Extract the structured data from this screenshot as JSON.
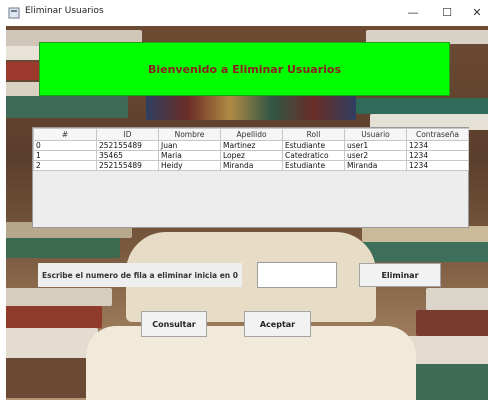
{
  "window": {
    "title": "Eliminar Usuarios",
    "minimize_glyph": "—",
    "maximize_glyph": "☐",
    "close_glyph": "✕"
  },
  "banner": {
    "text": "Bienvenido a Eliminar Usuarios"
  },
  "table": {
    "headers": [
      "#",
      "ID",
      "Nombre",
      "Apellido",
      "Roll",
      "Usuario",
      "Contraseña"
    ],
    "rows": [
      [
        "0",
        "252155489",
        "Juan",
        "Martinez",
        "Estudiante",
        "user1",
        "1234"
      ],
      [
        "1",
        "35465",
        "Maria",
        "Lopez",
        "Catedratico",
        "user2",
        "1234"
      ],
      [
        "2",
        "252155489",
        "Heidy",
        "Miranda",
        "Estudiante",
        "Miranda",
        "1234"
      ]
    ]
  },
  "form": {
    "instruction": "Escribe el numero de fila a eliminar inicia en 0",
    "row_value": "",
    "eliminar_label": "Eliminar",
    "consultar_label": "Consultar",
    "aceptar_label": "Aceptar"
  },
  "colors": {
    "banner_bg": "#00ff00",
    "banner_text": "#8b2020"
  },
  "icons": {
    "app": "window-app-icon"
  }
}
